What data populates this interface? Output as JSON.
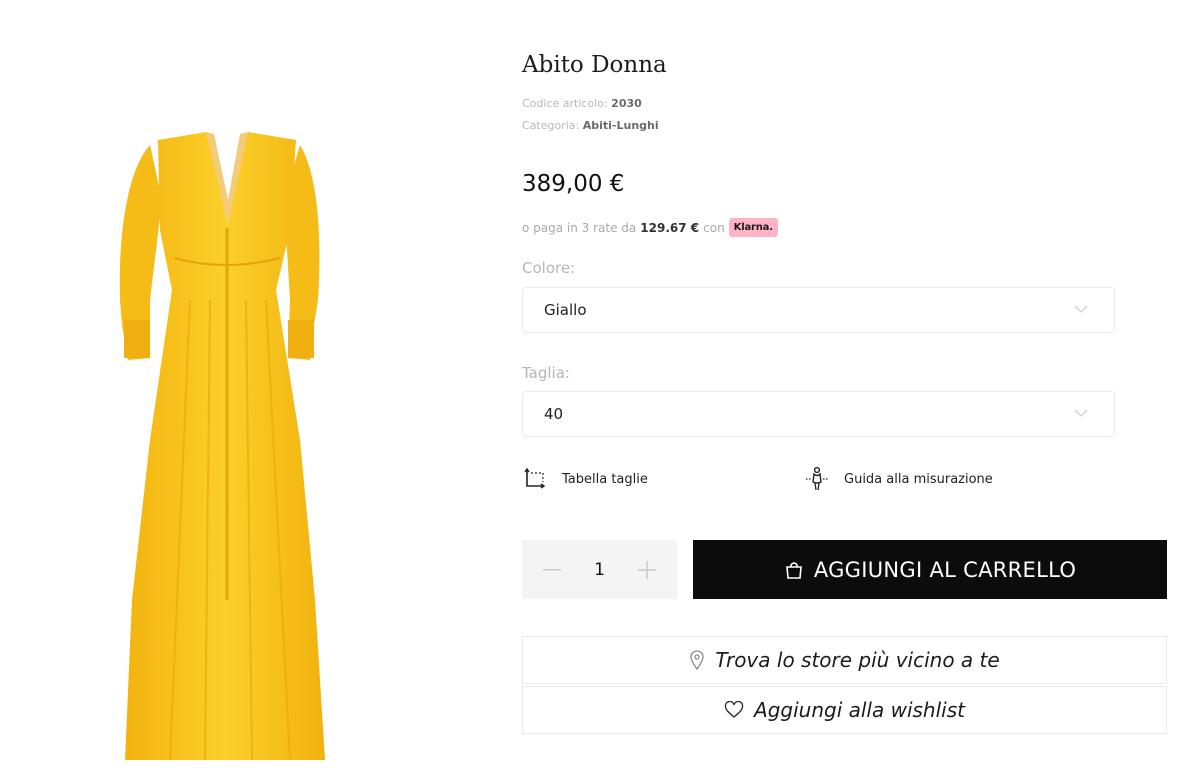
{
  "product": {
    "title": "Abito Donna",
    "code_label": "Codice articolo:",
    "code_value": "2030",
    "category_label": "Categoria:",
    "category_value": "Abiti-Lunghi",
    "price": "389,00 €",
    "installments": {
      "prefix": "o paga in 3 rate da",
      "amount": "129.67 €",
      "suffix": "con",
      "provider": "Klarna."
    },
    "image_alt": "yellow long dress"
  },
  "options": {
    "color_label": "Colore:",
    "color_value": "Giallo",
    "size_label": "Taglia:",
    "size_value": "40"
  },
  "links": {
    "size_table": "Tabella taglie",
    "measure_guide": "Guida alla misurazione"
  },
  "cart": {
    "quantity": "1",
    "add_label": "AGGIUNGI AL CARRELLO"
  },
  "actions": {
    "find_store": "Trova lo store più vicino a te",
    "wishlist": "Aggiungi alla wishlist"
  },
  "colors": {
    "dress": "#f7c21b",
    "klarna_badge": "#ffb3c7",
    "cart_button": "#0c0c0c"
  },
  "icons": [
    "chevron-down-icon",
    "size-table-icon",
    "measure-guide-icon",
    "minus-icon",
    "plus-icon",
    "shopping-bag-icon",
    "location-pin-icon",
    "heart-icon"
  ]
}
